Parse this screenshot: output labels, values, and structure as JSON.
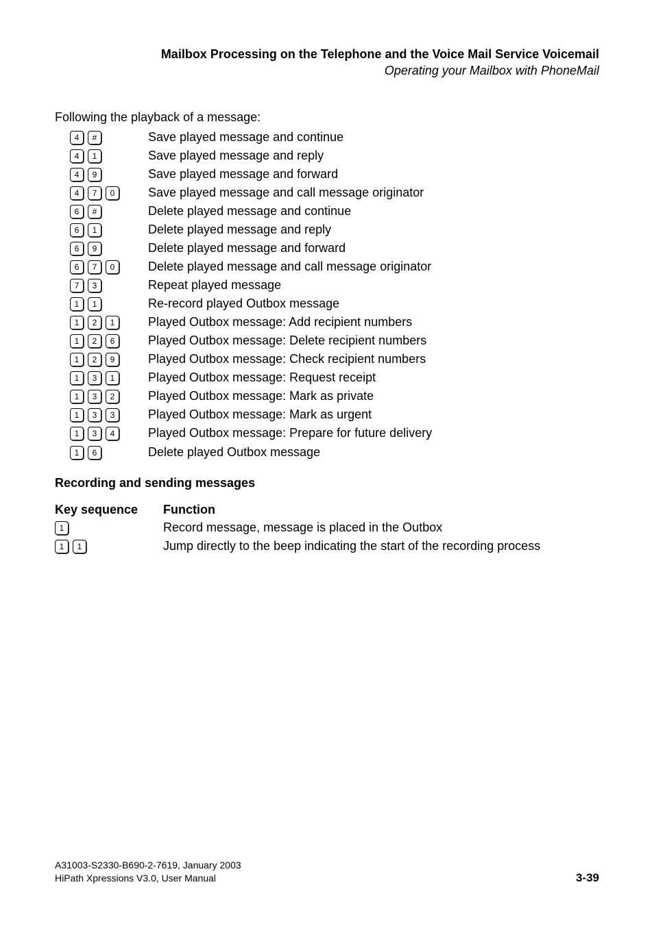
{
  "header": {
    "title": "Mailbox Processing on the Telephone and the Voice Mail Service Voicemail",
    "subtitle": "Operating your Mailbox with PhoneMail"
  },
  "intro": "Following the playback of a message:",
  "commands": [
    {
      "keys": [
        "4",
        "#"
      ],
      "func": "Save played message and continue"
    },
    {
      "keys": [
        "4",
        "1"
      ],
      "func": "Save played message and reply"
    },
    {
      "keys": [
        "4",
        "9"
      ],
      "func": "Save played message and forward"
    },
    {
      "keys": [
        "4",
        "7",
        "0"
      ],
      "func": "Save played message and call message originator"
    },
    {
      "keys": [
        "6",
        "#"
      ],
      "func": "Delete played message and continue"
    },
    {
      "keys": [
        "6",
        "1"
      ],
      "func": "Delete played message and reply"
    },
    {
      "keys": [
        "6",
        "9"
      ],
      "func": "Delete played message and forward"
    },
    {
      "keys": [
        "6",
        "7",
        "0"
      ],
      "func": "Delete played message and call message originator"
    },
    {
      "keys": [
        "7",
        "3"
      ],
      "func": "Repeat played message"
    },
    {
      "keys": [
        "1",
        "1"
      ],
      "func": "Re-record played Outbox message"
    },
    {
      "keys": [
        "1",
        "2",
        "1"
      ],
      "func": "Played Outbox message: Add recipient numbers"
    },
    {
      "keys": [
        "1",
        "2",
        "6"
      ],
      "func": "Played Outbox message: Delete recipient numbers"
    },
    {
      "keys": [
        "1",
        "2",
        "9"
      ],
      "func": "Played Outbox message: Check recipient numbers"
    },
    {
      "keys": [
        "1",
        "3",
        "1"
      ],
      "func": "Played Outbox message: Request receipt"
    },
    {
      "keys": [
        "1",
        "3",
        "2"
      ],
      "func": "Played Outbox message: Mark as private"
    },
    {
      "keys": [
        "1",
        "3",
        "3"
      ],
      "func": "Played Outbox message: Mark as urgent"
    },
    {
      "keys": [
        "1",
        "3",
        "4"
      ],
      "func": "Played Outbox message: Prepare for future delivery"
    },
    {
      "keys": [
        "1",
        "6"
      ],
      "func": "Delete played Outbox message"
    }
  ],
  "section2": {
    "heading": "Recording and sending messages",
    "col_left": "Key sequence",
    "col_right": "Function",
    "rows": [
      {
        "keys": [
          "1"
        ],
        "func": "Record message, message is placed in the Outbox"
      },
      {
        "keys": [
          "1",
          "1"
        ],
        "func": "Jump directly to the beep indicating the start of the recording process"
      }
    ]
  },
  "footer": {
    "line1": "A31003-S2330-B690-2-7619, January 2003",
    "line2": "HiPath Xpressions V3.0, User Manual",
    "page": "3-39"
  }
}
